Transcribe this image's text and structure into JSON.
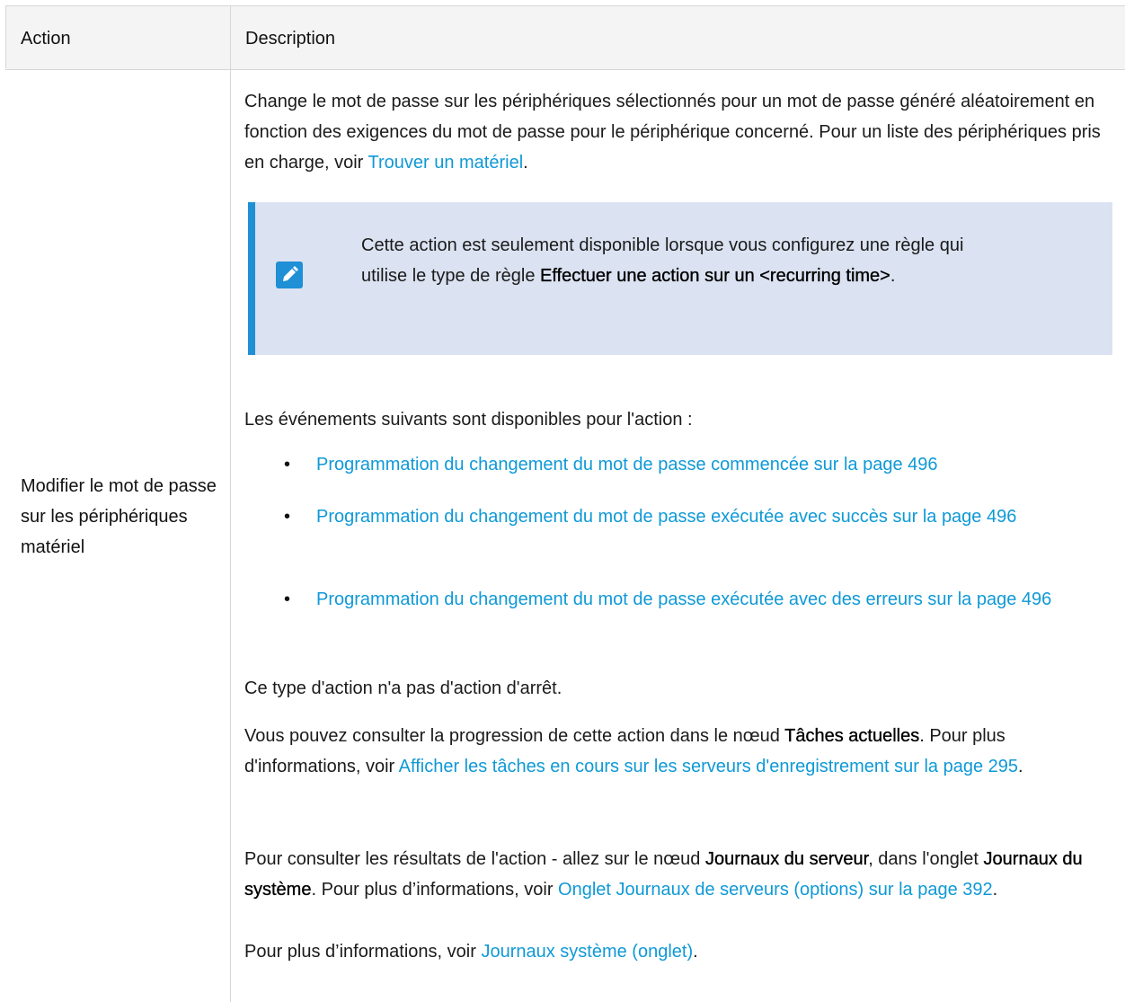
{
  "table": {
    "header": {
      "action": "Action",
      "description": "Description"
    },
    "action_name": "Modifier le mot de passe sur les périphériques matériel",
    "intro": {
      "text": "Change le mot de passe sur les périphériques sélectionnés pour un mot de passe généré aléatoirement en fonction des exigences du mot de passe pour le périphérique concerné. Pour un liste des périphériques pris en charge, voir ",
      "link": "Trouver un matériel",
      "end": "."
    },
    "note": {
      "icon": "pencil-icon",
      "text1": "Cette action est seulement disponible lorsque vous configurez une règle qui utilise le type de règle ",
      "bold": "Effectuer une action sur un <recurring time>",
      "end": "."
    },
    "events_intro": "Les événements suivants sont disponibles pour l'action :",
    "events": [
      "Programmation du changement du mot de passe commencée sur la page 496",
      "Programmation du changement du mot de passe exécutée avec succès sur la page 496",
      "Programmation du changement du mot de passe exécutée avec des erreurs sur la page 496"
    ],
    "stop_text": "Ce type d'action n'a pas d'action d'arrêt.",
    "progress": {
      "text1": "Vous pouvez consulter la progression de cette action dans le nœud ",
      "bold": "Tâches actuelles",
      "text2": ". Pour plus d'informations, voir ",
      "link": "Afficher les tâches en cours sur les serveurs d'enregistrement sur la page 295",
      "end": "."
    },
    "results": {
      "text1": "Pour consulter les résultats de l'action - allez sur le nœud ",
      "bold1": "Journaux du serveur",
      "text2": ", dans l'onglet ",
      "bold2": "Journaux du système",
      "text3": ". Pour plus d’informations, voir ",
      "link": "Onglet Journaux de serveurs (options) sur la page 392",
      "end": "."
    },
    "more": {
      "text": "Pour plus d’informations, voir ",
      "link": "Journaux système (onglet)",
      "end": "."
    }
  },
  "colors": {
    "link": "#0f99d6",
    "note_bg": "#dbe2f1",
    "note_accent": "#1f8fd6",
    "header_bg": "#f4f4f4"
  }
}
